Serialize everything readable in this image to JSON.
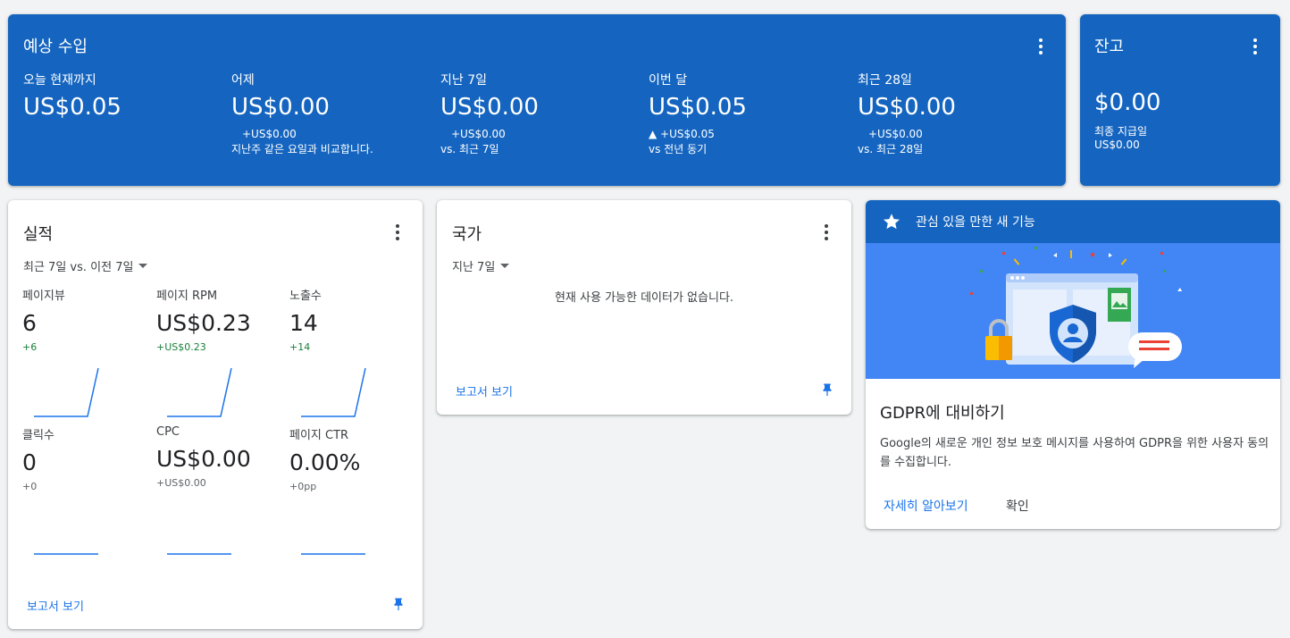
{
  "earnings": {
    "title": "예상 수입",
    "metrics": [
      {
        "label": "오늘 현재까지",
        "value": "US$0.05",
        "change": "",
        "compare": ""
      },
      {
        "label": "어제",
        "value": "US$0.00",
        "change": "+US$0.00",
        "compare": "지난주 같은 요일과 비교합니다."
      },
      {
        "label": "지난 7일",
        "value": "US$0.00",
        "change": "+US$0.00",
        "compare": "vs. 최근 7일"
      },
      {
        "label": "이번 달",
        "value": "US$0.05",
        "change": "▲ +US$0.05",
        "compare": "vs 전년 동기"
      },
      {
        "label": "최근 28일",
        "value": "US$0.00",
        "change": "+US$0.00",
        "compare": "vs. 최근 28일"
      }
    ]
  },
  "balance": {
    "title": "잔고",
    "value": "$0.00",
    "last_payment_label": "최종 지급일",
    "last_payment_value": "US$0.00"
  },
  "performance": {
    "title": "실적",
    "range": "최근 7일 vs. 이전 7일",
    "metrics": [
      {
        "label": "페이지뷰",
        "value": "6",
        "change": "+6",
        "trend": [
          0,
          0,
          0,
          0,
          0,
          0,
          1
        ]
      },
      {
        "label": "페이지 RPM",
        "value": "US$0.23",
        "change": "+US$0.23",
        "trend": [
          0,
          0,
          0,
          0,
          0,
          0,
          1
        ]
      },
      {
        "label": "노출수",
        "value": "14",
        "change": "+14",
        "trend": [
          0,
          0,
          0,
          0,
          0,
          0,
          1
        ]
      },
      {
        "label": "클릭수",
        "value": "0",
        "change": "+0",
        "trend": [
          0,
          0,
          0,
          0,
          0,
          0,
          0
        ]
      },
      {
        "label": "CPC",
        "value": "US$0.00",
        "change": "+US$0.00",
        "trend": [
          0,
          0,
          0,
          0,
          0,
          0,
          0
        ]
      },
      {
        "label": "페이지 CTR",
        "value": "0.00%",
        "change": "+0pp",
        "trend": [
          0,
          0,
          0,
          0,
          0,
          0,
          0
        ]
      }
    ],
    "report_link": "보고서 보기"
  },
  "country": {
    "title": "국가",
    "range": "지난 7일",
    "empty_message": "현재 사용 가능한 데이터가 없습니다.",
    "report_link": "보고서 보기"
  },
  "feature": {
    "header": "관심 있을 만한 새 기능",
    "title": "GDPR에 대비하기",
    "description": "Google의 새로운 개인 정보 보호 메시지를 사용하여 GDPR을 위한 사용자 동의를 수집합니다.",
    "learn_more": "자세히 알아보기",
    "confirm": "확인"
  },
  "colors": {
    "primary_blue": "#1565c0",
    "link_blue": "#1a73e8",
    "positive_green": "#188038",
    "illustration_blue": "#4285f4"
  },
  "icons": [
    "more-vert-icon",
    "dropdown-arrow-icon",
    "pin-icon",
    "star-icon",
    "gdpr-shield-icon",
    "lock-icon"
  ]
}
